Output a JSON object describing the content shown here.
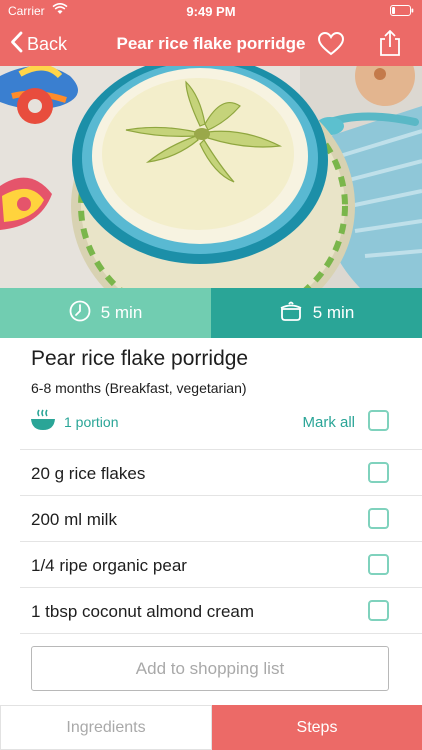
{
  "status_bar": {
    "carrier": "Carrier",
    "time": "9:49 PM"
  },
  "nav": {
    "back_label": "Back",
    "title": "Pear rice flake porridge",
    "icons": [
      "chevron-left-icon",
      "heart-icon",
      "share-icon"
    ]
  },
  "hero": {
    "image": "pear-rice-flake-porridge-photo"
  },
  "times": {
    "prep": "5 min",
    "cook": "5 min",
    "prep_icon": "clock-icon",
    "cook_icon": "pot-icon"
  },
  "recipe": {
    "title": "Pear rice flake porridge",
    "subtitle": "6-8 months (Breakfast, vegetarian)",
    "portion": "1 portion",
    "mark_all": "Mark all"
  },
  "ingredients": [
    {
      "text": "20 g rice flakes",
      "checked": false
    },
    {
      "text": "200 ml milk",
      "checked": false
    },
    {
      "text": "1/4 ripe organic pear",
      "checked": false
    },
    {
      "text": "1 tbsp coconut almond cream",
      "checked": false
    }
  ],
  "add_to_list": "Add to shopping list",
  "tabs": {
    "ingredients": "Ingredients",
    "steps": "Steps",
    "active": "Steps"
  },
  "colors": {
    "brand_red": "#ec6a67",
    "mint": "#71cdb1",
    "teal": "#2aa597"
  }
}
